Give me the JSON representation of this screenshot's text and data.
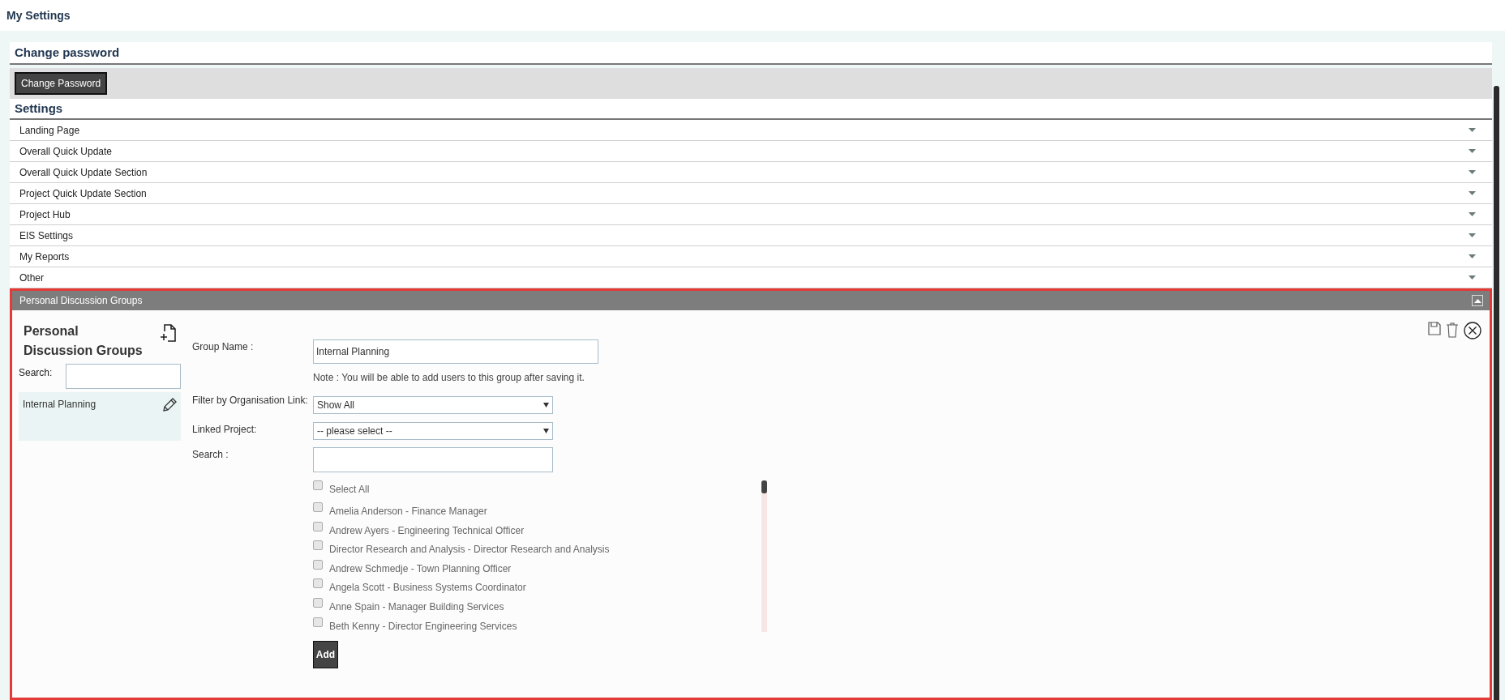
{
  "page_title": "My Settings",
  "change_password": {
    "heading": "Change password",
    "button": "Change Password"
  },
  "settings": {
    "heading": "Settings",
    "sections": [
      {
        "label": "Landing Page",
        "expanded": false
      },
      {
        "label": "Overall Quick Update",
        "expanded": false
      },
      {
        "label": "Overall Quick Update Section",
        "expanded": false
      },
      {
        "label": "Project Quick Update Section",
        "expanded": false
      },
      {
        "label": "Project Hub",
        "expanded": false
      },
      {
        "label": "EIS Settings",
        "expanded": false
      },
      {
        "label": "My Reports",
        "expanded": false
      },
      {
        "label": "Other",
        "expanded": false
      }
    ]
  },
  "discussion_panel": {
    "header": "Personal Discussion Groups",
    "expanded": true,
    "sidebar": {
      "title": "Personal Discussion Groups",
      "search_label": "Search:",
      "groups": [
        {
          "name": "Internal Planning",
          "selected": true
        }
      ]
    },
    "form": {
      "group_name_label": "Group Name :",
      "group_name_value": "Internal Planning",
      "note": "Note : You will be able to add users to this group after saving it.",
      "filter_label": "Filter by Organisation Link:",
      "filter_value": "Show All",
      "project_label": "Linked Project:",
      "project_value": "-- please select --",
      "search_label": "Search :",
      "select_all": {
        "label": "Select All",
        "checked": false
      },
      "users": [
        {
          "name": "Amelia Anderson - Finance Manager",
          "checked": false
        },
        {
          "name": "Andrew Ayers - Engineering Technical Officer",
          "checked": false
        },
        {
          "name": "Director Research and Analysis - Director Research and Analysis",
          "checked": false
        },
        {
          "name": "Andrew Schmedje - Town Planning Officer",
          "checked": false
        },
        {
          "name": "Angela Scott - Business Systems Coordinator",
          "checked": false
        },
        {
          "name": "Anne Spain - Manager Building Services",
          "checked": false
        },
        {
          "name": "Beth Kenny - Director Engineering Services",
          "checked": false
        }
      ],
      "add_button": "Add"
    }
  }
}
